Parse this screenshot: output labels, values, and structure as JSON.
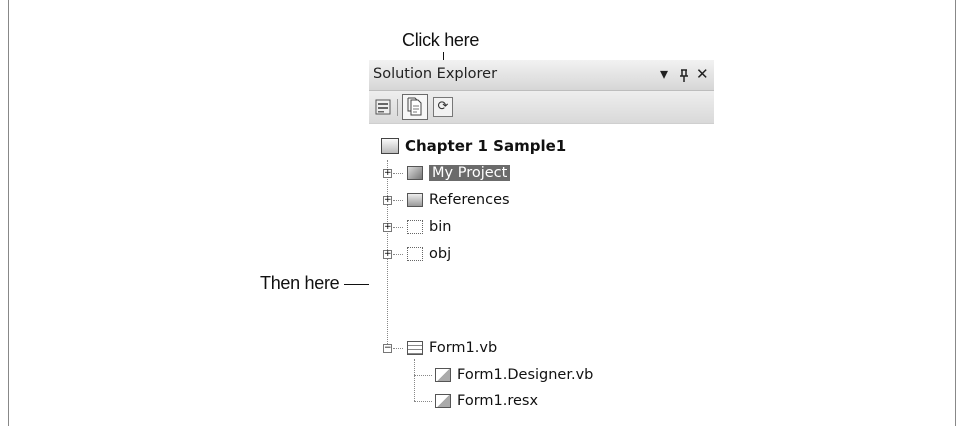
{
  "annotations": {
    "click_here": "Click here",
    "then_here": "Then here"
  },
  "panel": {
    "title": "Solution Explorer",
    "dropdown_glyph": "▾",
    "pin_glyph": "ᵻ",
    "close_glyph": "✕"
  },
  "toolbar": {
    "buttons": [
      "properties",
      "show-all-files",
      "refresh"
    ],
    "refresh_glyph": "⟳"
  },
  "tree": {
    "root": "Chapter 1 Sample1",
    "items": [
      {
        "label": "My Project",
        "selected": true,
        "expander": "+"
      },
      {
        "label": "References",
        "expander": "+"
      },
      {
        "label": "bin",
        "expander": "+"
      },
      {
        "label": "obj",
        "expander": "+"
      },
      {
        "label": "Form1.vb",
        "expander": "−"
      }
    ],
    "children": [
      {
        "label": "Form1.Designer.vb"
      },
      {
        "label": "Form1.resx"
      }
    ]
  }
}
